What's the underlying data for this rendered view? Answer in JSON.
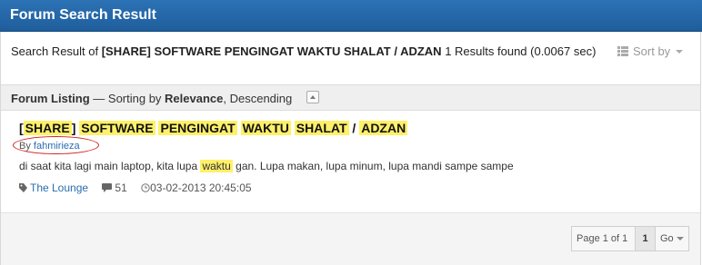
{
  "header": {
    "title": "Forum Search Result"
  },
  "summary": {
    "prefix": "Search Result of ",
    "query": "[SHARE] SOFTWARE PENGINGAT WAKTU SHALAT / ADZAN",
    "suffix": " 1 Results found (0.0067 sec)",
    "sort_label": "Sort by"
  },
  "listing": {
    "label": "Forum Listing",
    "sep": " — Sorting by ",
    "sort_field": "Relevance",
    "order": ", Descending"
  },
  "result": {
    "title_parts": {
      "open": "[",
      "share": "SHARE",
      "close": "]",
      "w1": "SOFTWARE",
      "w2": "PENGINGAT",
      "w3": "WAKTU",
      "w4": "SHALAT",
      "slash": "/",
      "w5": "ADZAN"
    },
    "author_prefix": "By ",
    "author": "fahmirieza",
    "snippet_before": "di saat kita lagi main laptop, kita lupa ",
    "snippet_highlight": "waktu",
    "snippet_after": " gan. Lupa makan, lupa minum, lupa mandi sampe sampe",
    "forum": "The Lounge",
    "replies": "51",
    "date": "03-02-2013 20:45:05"
  },
  "pager": {
    "page_info": "Page 1 of 1",
    "current": "1",
    "go_label": "Go"
  },
  "colors": {
    "highlight": "#fff06a",
    "header": "#2a6db0",
    "annotation": "#d21f1f"
  }
}
